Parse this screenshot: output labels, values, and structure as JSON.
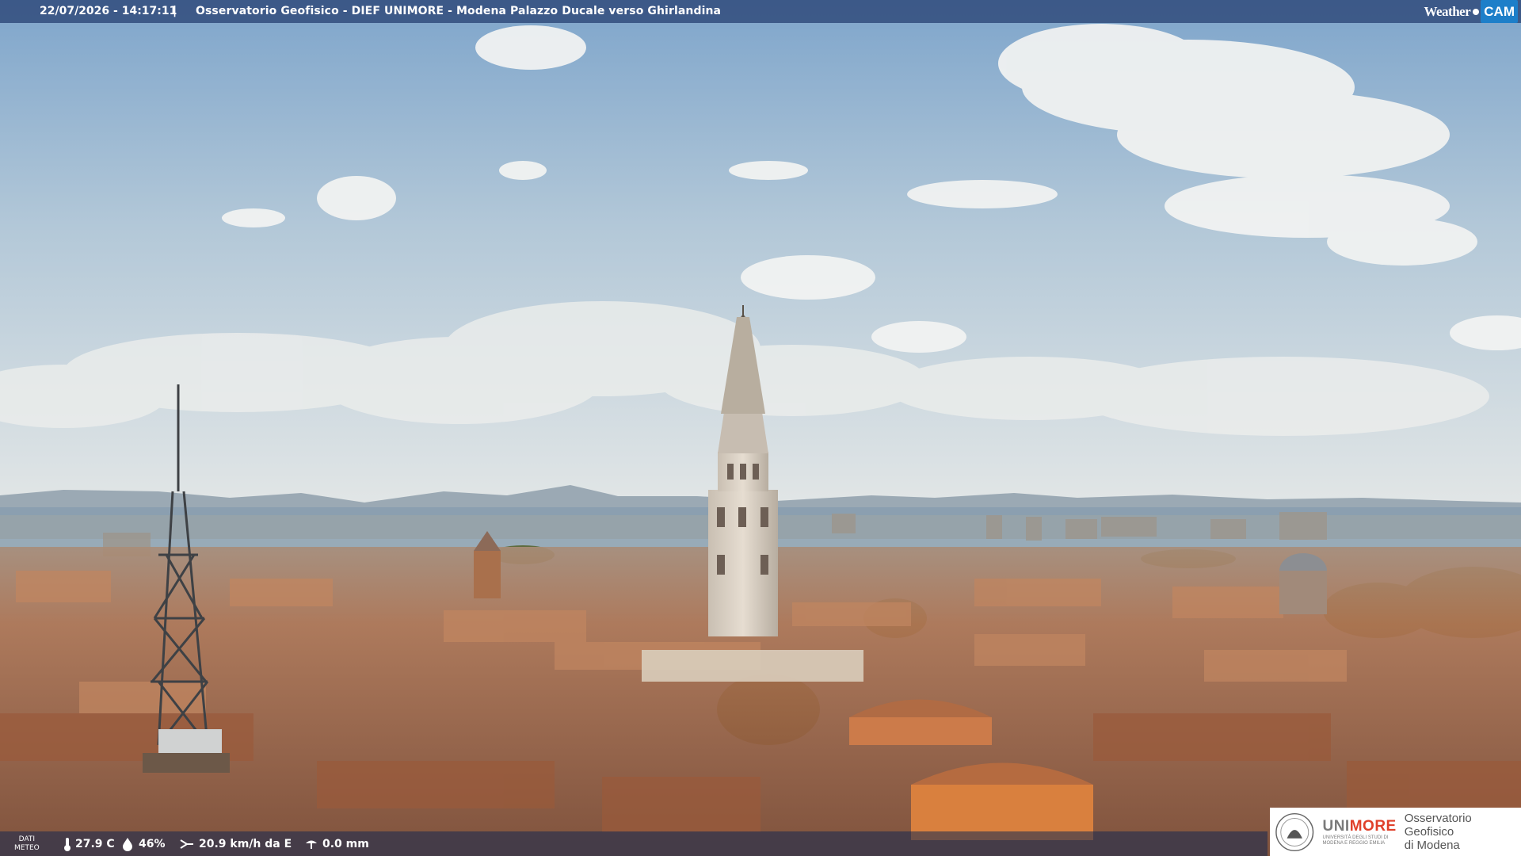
{
  "header": {
    "timestamp": "22/07/2026 - 14:17:11",
    "separator": "|",
    "title": "Osservatorio Geofisico - DIEF UNIMORE - Modena Palazzo Ducale verso Ghirlandina"
  },
  "brand": {
    "weather_label": "Weather",
    "cam_label": "CAM"
  },
  "weather": {
    "dati_label_line1": "DATI",
    "dati_label_line2": "METEO",
    "temperature": "27.9 C",
    "humidity": "46%",
    "wind": "20.9 km/h da E",
    "rain": "0.0 mm"
  },
  "logo": {
    "uni_name_grey": "UNI",
    "uni_name_red": "MORE",
    "uni_sub_line1": "UNIVERSITÀ DEGLI STUDI DI",
    "uni_sub_line2": "MODENA E REGGIO EMILIA",
    "obs_line1": "Osservatorio Geofisico",
    "obs_line2": "di Modena"
  },
  "colors": {
    "sky_top": "#7fa6cc",
    "sky_bottom": "#dfe6ea",
    "roofs": "#b0714a",
    "tower": "#d8cfc2"
  }
}
